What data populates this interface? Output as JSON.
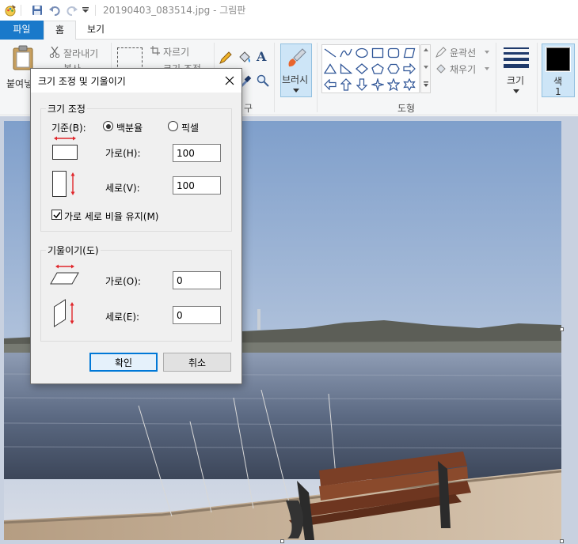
{
  "window": {
    "title": "20190403_083514.jpg - 그림판"
  },
  "tabs": [
    {
      "label": "파일"
    },
    {
      "label": "홈"
    },
    {
      "label": "보기"
    }
  ],
  "ribbon": {
    "clipboard": {
      "paste_label": "붙여넣",
      "cut_label": "잘라내기",
      "copy_label": "복사"
    },
    "image": {
      "crop_label": "자르기",
      "resize_label": "크기 조정"
    },
    "tools_group_label": "구",
    "brush_label": "브러시",
    "shapes": {
      "group_label": "도형",
      "outline_label": "윤곽선",
      "fill_label": "채우기"
    },
    "size_label": "크기",
    "color1_label": "색",
    "color1_number": "1",
    "color1_value": "#000000"
  },
  "dialog": {
    "title": "크기 조정 및 기울이기",
    "resize": {
      "legend": "크기 조정",
      "by_label": "기준(B):",
      "percent_label": "백분율",
      "pixels_label": "픽셀",
      "selected_unit": "percent",
      "horizontal_label": "가로(H):",
      "horizontal_value": "100",
      "vertical_label": "세로(V):",
      "vertical_value": "100",
      "keep_ratio_label": "가로 세로 비율 유지(M)",
      "keep_ratio_checked": true
    },
    "skew": {
      "legend": "기울이기(도)",
      "horizontal_label": "가로(O):",
      "horizontal_value": "0",
      "vertical_label": "세로(E):",
      "vertical_value": "0"
    },
    "ok_label": "확인",
    "cancel_label": "취소"
  },
  "colors": {
    "accent": "#1979ca",
    "arrow_red": "#e0262b",
    "ribbon_bg": "#f5f6f7",
    "workspace_bg": "#c8d1e0"
  }
}
